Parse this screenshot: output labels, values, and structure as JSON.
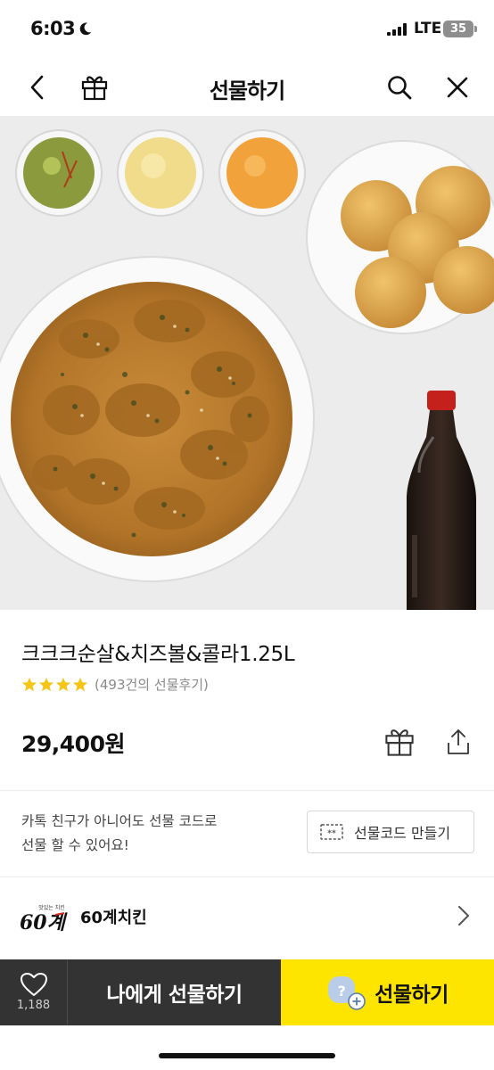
{
  "status_bar": {
    "time": "6:03",
    "network": "LTE",
    "battery": "35"
  },
  "header": {
    "title": "선물하기",
    "icons": [
      "back-icon",
      "gift-icon",
      "search-icon",
      "close-icon"
    ]
  },
  "product": {
    "name": "크크크순살&치즈볼&콜라1.25L",
    "rating_stars": 4,
    "review_text": "(493건의 선물후기)",
    "price": "29,400원"
  },
  "gift_code": {
    "description_line1": "카톡 친구가 아니어도 선물 코드로",
    "description_line2": "선물 할 수 있어요!",
    "button_label": "선물코드 만들기"
  },
  "brand": {
    "logo_text": "60계",
    "logo_tagline": "맛있는 치킨",
    "name": "60계치킨"
  },
  "bottom_bar": {
    "like_count": "1,188",
    "self_gift_label": "나에게 선물하기",
    "gift_label": "선물하기"
  },
  "colors": {
    "accent_yellow": "#fee500",
    "dark_bar": "#333333",
    "star": "#f5c518"
  }
}
